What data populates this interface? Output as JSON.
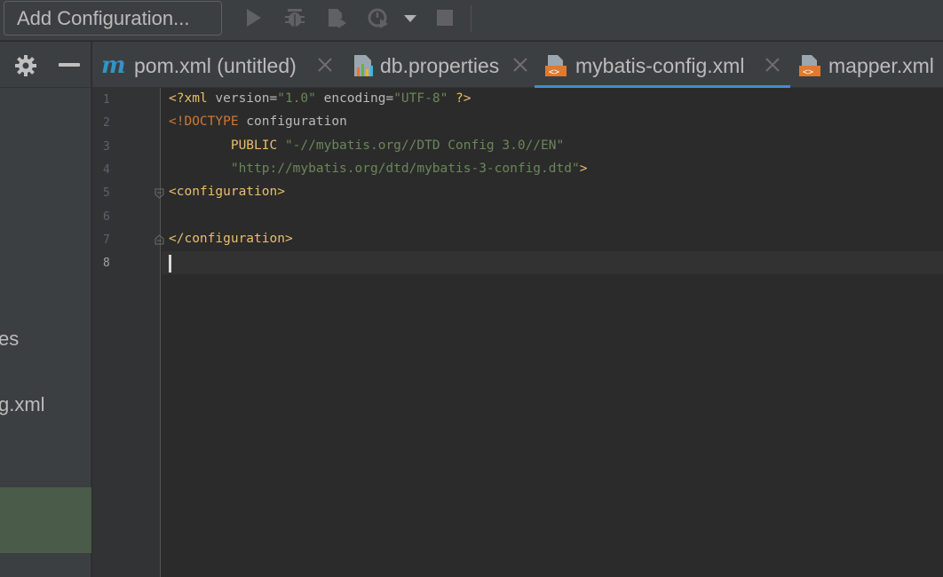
{
  "toolbar": {
    "add_config_label": "Add Configuration...",
    "icons": [
      "run-icon",
      "debug-icon",
      "coverage-icon",
      "profile-icon",
      "dropdown-icon",
      "stop-icon"
    ]
  },
  "left_panel": {
    "partial_item_1": "es",
    "partial_item_2": "g.xml",
    "icons": [
      "gear-icon",
      "minimize-icon"
    ]
  },
  "tabs": [
    {
      "label": "pom.xml (untitled)",
      "icon": "maven-icon",
      "closable": true,
      "active": false
    },
    {
      "label": "db.properties",
      "icon": "properties-icon",
      "closable": true,
      "active": false
    },
    {
      "label": "mybatis-config.xml",
      "icon": "xml-file-icon",
      "closable": true,
      "active": true
    },
    {
      "label": "mapper.xml",
      "icon": "xml-file-icon",
      "closable": false,
      "active": false
    }
  ],
  "editor": {
    "line_numbers": [
      "1",
      "2",
      "3",
      "4",
      "5",
      "6",
      "7",
      "8"
    ],
    "current_line": "8",
    "lines": {
      "l1": {
        "t1": "<?xml",
        "t2": " version=",
        "t3": "\"1.0\"",
        "t4": " encoding=",
        "t5": "\"UTF-8\"",
        "t6": " ?>"
      },
      "l2": {
        "t1": "<!DOCTYPE",
        "t2": " configuration"
      },
      "l3": {
        "t1": "        PUBLIC ",
        "t2": "\"-//mybatis.org//DTD Config 3.0//EN\""
      },
      "l4": {
        "t1": "        \"http://mybatis.org/dtd/mybatis-3-config.dtd\"",
        "t2": ">"
      },
      "l5": {
        "t1": "<configuration>"
      },
      "l7": {
        "t1": "</configuration>"
      }
    }
  },
  "colors": {
    "tag": "#e8bf6a",
    "string": "#6a8759",
    "keyword": "#cc7832",
    "active_tab_underline": "#4a88c7",
    "selected_tree_row": "#4b5b4a"
  }
}
